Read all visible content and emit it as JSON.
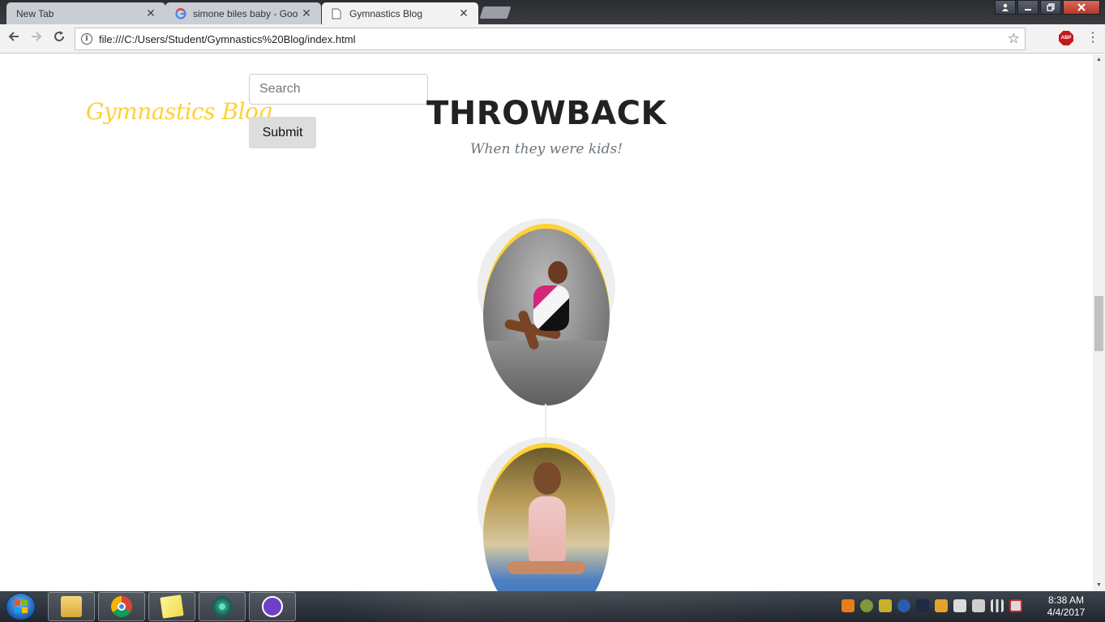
{
  "browser": {
    "tabs": [
      {
        "title": "New Tab",
        "close": "✕",
        "active": false
      },
      {
        "title": "simone biles baby - Goo",
        "close": "✕",
        "active": false
      },
      {
        "title": "Gymnastics Blog",
        "close": "✕",
        "active": true
      }
    ],
    "url": "file:///C:/Users/Student/Gymnastics%20Blog/index.html",
    "extension_badge": "ABP"
  },
  "page": {
    "brand": "Gymnastics Blog",
    "search": {
      "placeholder": "Search",
      "value": ""
    },
    "submit_label": "Submit",
    "heading": "THROWBACK",
    "subheading": "When they were kids!"
  },
  "taskbar": {
    "time": "8:38 AM",
    "date": "4/4/2017"
  },
  "colors": {
    "accent": "#fed136",
    "heading": "#222222",
    "muted": "#6c757d"
  }
}
